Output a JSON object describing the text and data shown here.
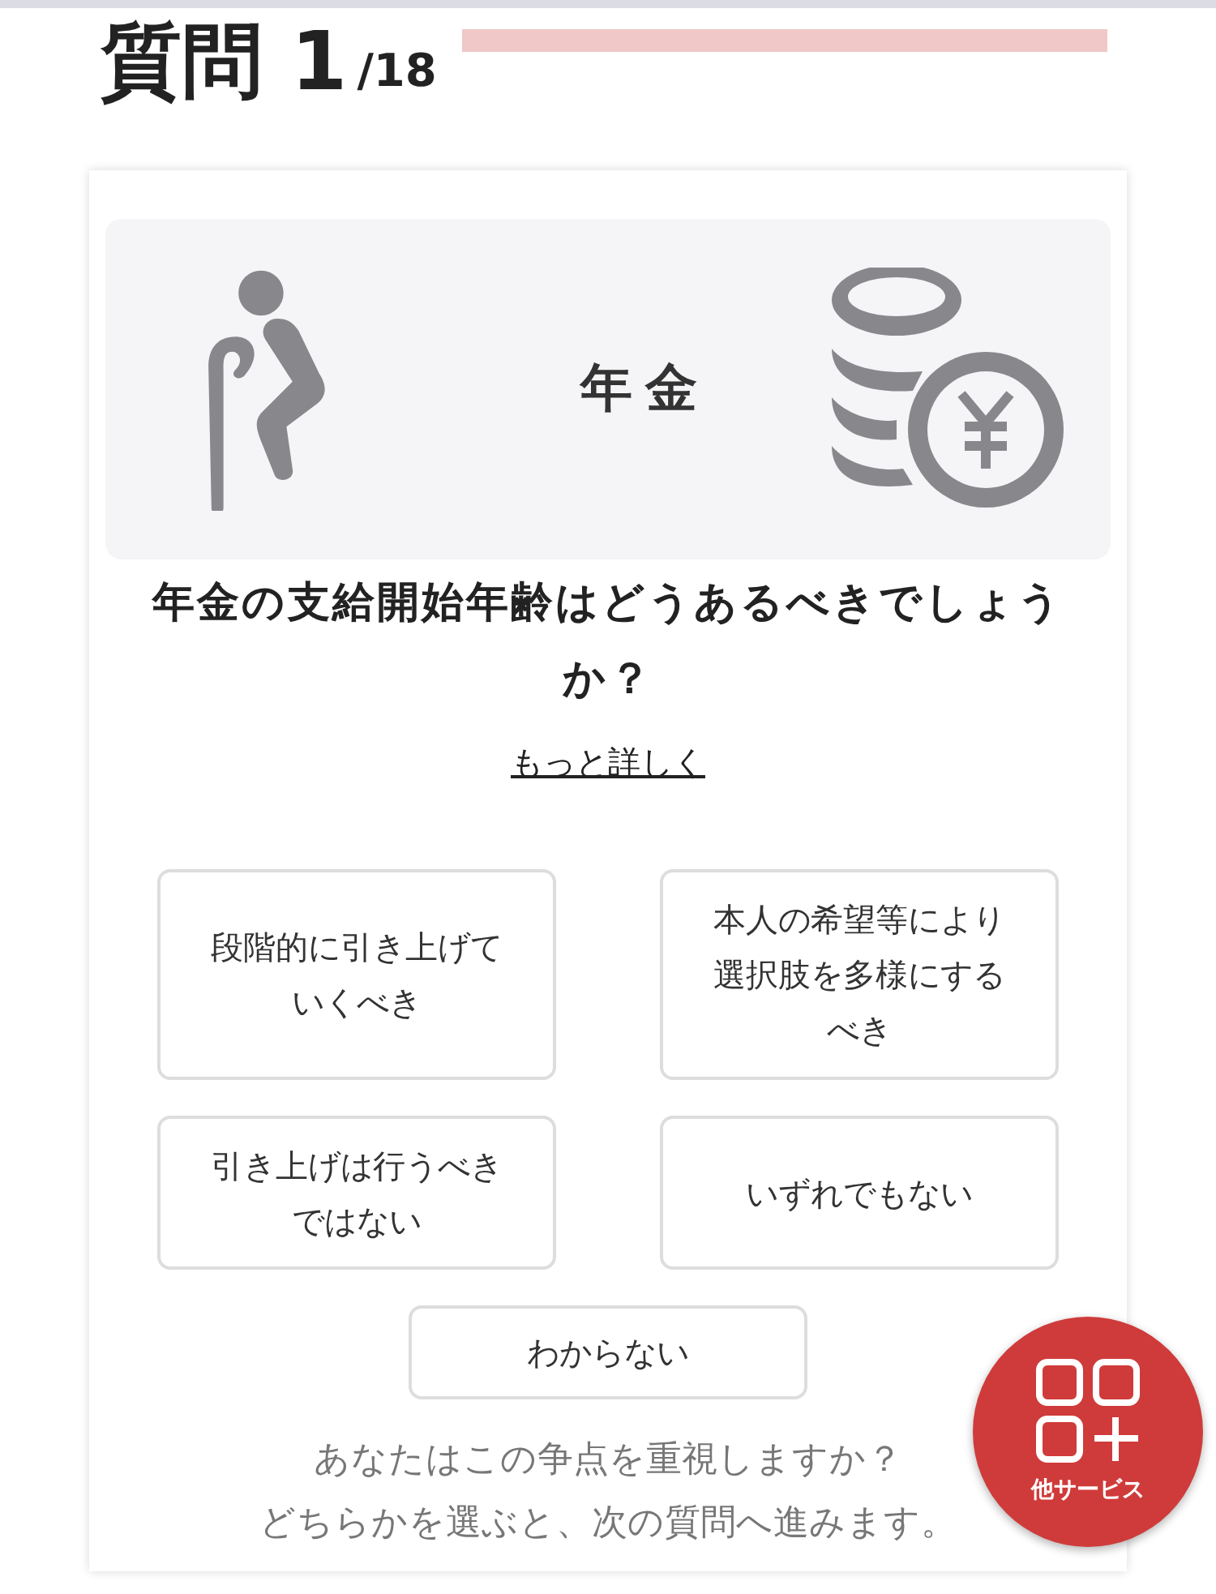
{
  "header": {
    "label": "質問",
    "number": "1",
    "total": "/18",
    "progress": {
      "level": 0
    }
  },
  "topic": {
    "title": "年金"
  },
  "question": "年金の支給開始年齢はどうあるべきでしょうか？",
  "more_link": "もっと詳しく",
  "options": [
    {
      "label": "段階的に引き上げていくべき"
    },
    {
      "label": "本人の希望等により選択肢を多様にするべき"
    },
    {
      "label": "引き上げは行うべきではない"
    },
    {
      "label": "いずれでもない"
    },
    {
      "label": "わからない"
    }
  ],
  "notes": [
    "あなたはこの争点を重視しますか？",
    "どちらかを選ぶと、次の質問へ進みます。"
  ],
  "fab": {
    "label": "他サービス"
  }
}
